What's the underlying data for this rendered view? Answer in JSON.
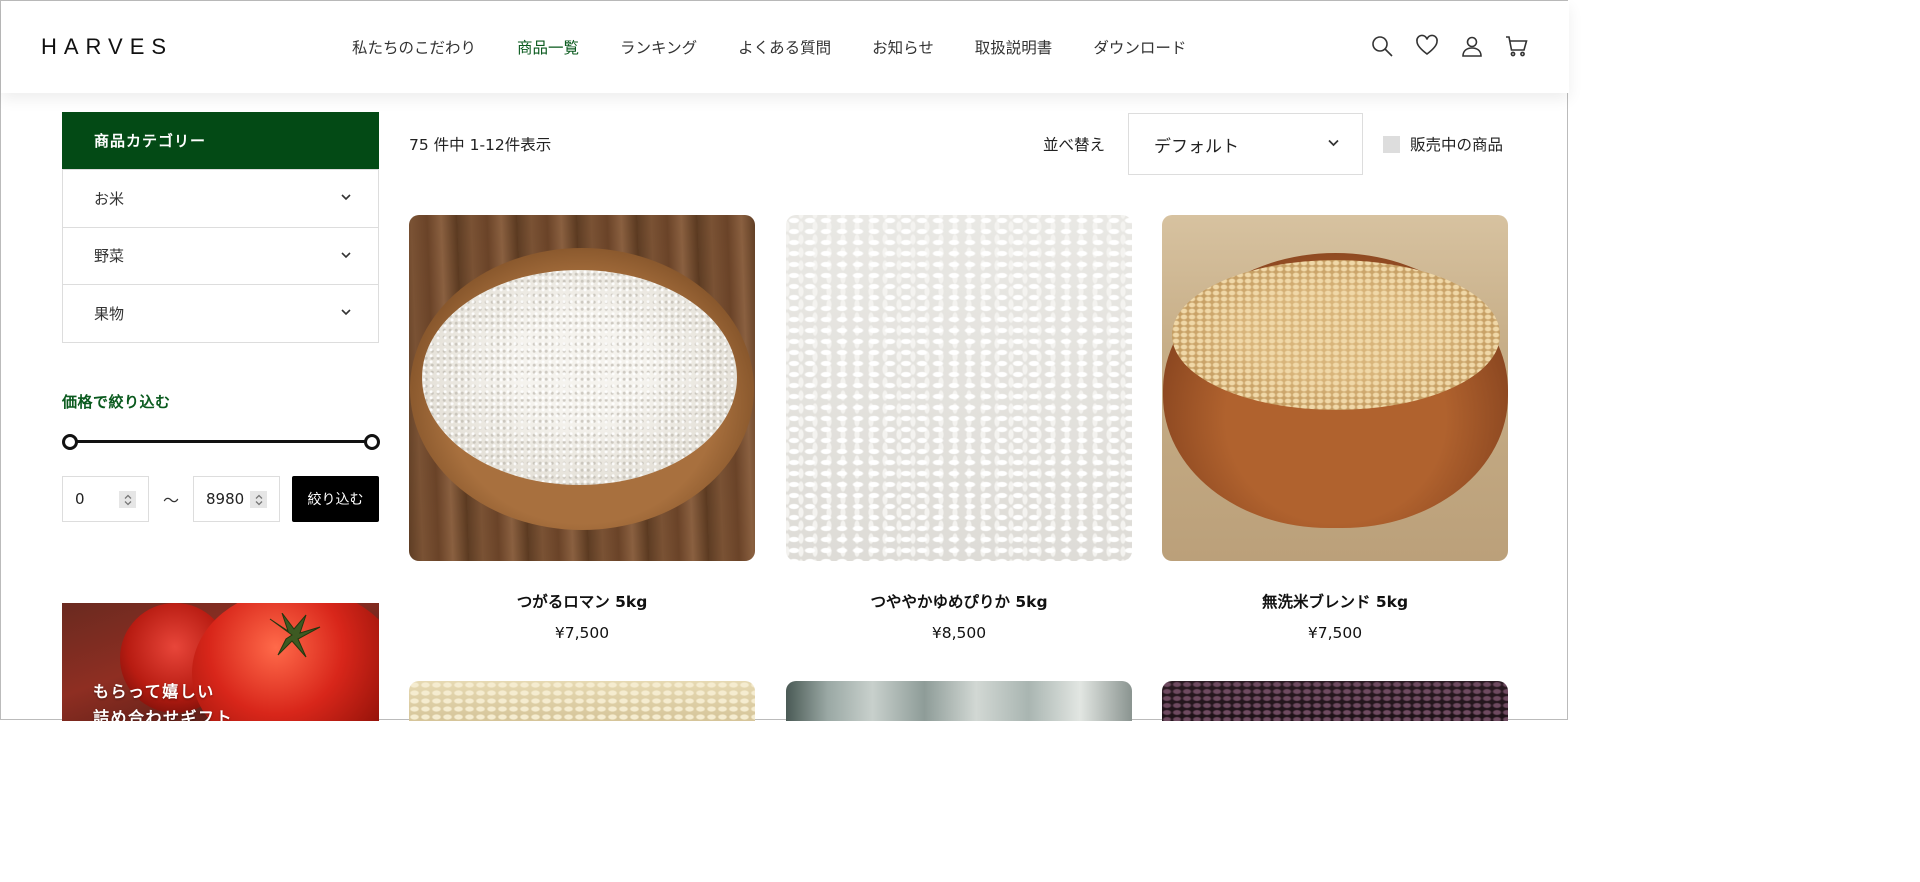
{
  "header": {
    "logo": "HARVES",
    "nav": [
      {
        "label": "私たちのこだわり",
        "active": false
      },
      {
        "label": "商品一覧",
        "active": true
      },
      {
        "label": "ランキング",
        "active": false
      },
      {
        "label": "よくある質問",
        "active": false
      },
      {
        "label": "お知らせ",
        "active": false
      },
      {
        "label": "取扱説明書",
        "active": false
      },
      {
        "label": "ダウンロード",
        "active": false
      }
    ],
    "icons": [
      "search-icon",
      "heart-icon",
      "user-icon",
      "cart-icon"
    ]
  },
  "sidebar": {
    "category_title": "商品カテゴリー",
    "categories": [
      {
        "label": "お米"
      },
      {
        "label": "野菜"
      },
      {
        "label": "果物"
      }
    ],
    "price_filter": {
      "title": "価格で絞り込む",
      "min_value": "0",
      "max_value": "8980",
      "separator": "〜",
      "button_label": "絞り込む"
    },
    "banner": {
      "line1": "もらって嬉しい",
      "line2": "詰め合わせギフト"
    }
  },
  "toolbar": {
    "result_count": "75 件中 1-12件表示",
    "sort_label": "並べ替え",
    "sort_value": "デフォルト",
    "onsale_label": "販売中の商品"
  },
  "products": [
    {
      "name": "つがるロマン 5kg",
      "price": "¥7,500"
    },
    {
      "name": "つややかゆめぴりか 5kg",
      "price": "¥8,500"
    },
    {
      "name": "無洗米ブレンド 5kg",
      "price": "¥7,500"
    }
  ],
  "colors": {
    "brand_green": "#034a15",
    "active_nav": "#0a5a1e",
    "button_black": "#000000"
  }
}
